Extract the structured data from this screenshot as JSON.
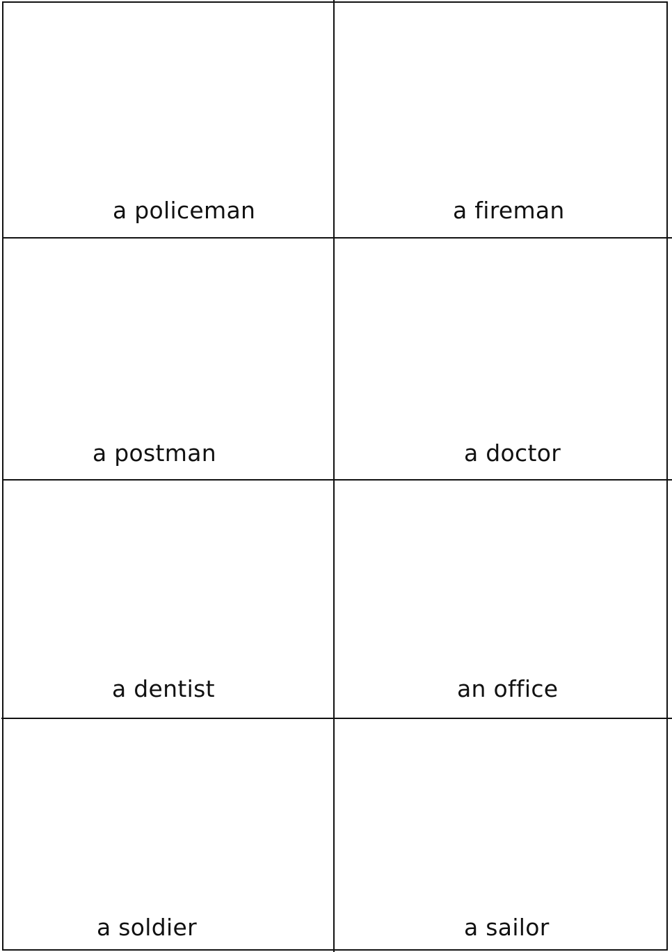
{
  "cards": [
    {
      "label": "a policeman"
    },
    {
      "label": "a fireman"
    },
    {
      "label": "a postman"
    },
    {
      "label": "a doctor"
    },
    {
      "label": "a dentist"
    },
    {
      "label": "an office"
    },
    {
      "label": "a soldier"
    },
    {
      "label": "a sailor"
    }
  ],
  "colors": {
    "line": "#111111",
    "background": "#ffffff"
  }
}
